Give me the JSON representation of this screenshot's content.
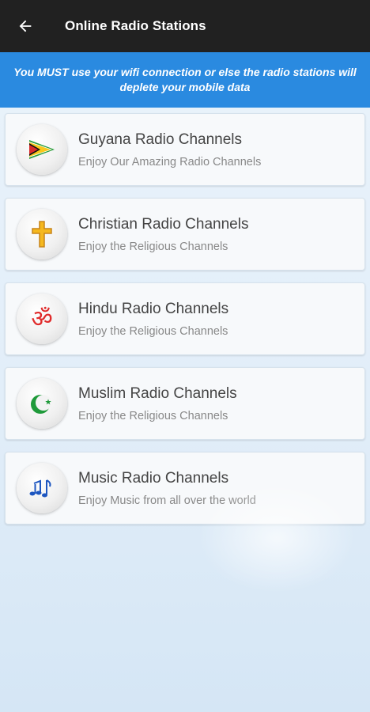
{
  "appbar": {
    "title": "Online Radio Stations",
    "back_icon": "arrow-left-icon"
  },
  "banner": {
    "text": "You MUST use your wifi connection or else the radio stations will deplete your mobile data"
  },
  "colors": {
    "appbar": "#212121",
    "banner": "#2a8ae0",
    "card_bg": "#f7f9fb"
  },
  "channels": [
    {
      "title": "Guyana Radio Channels",
      "subtitle": "Enjoy Our Amazing Radio Channels",
      "icon": "guyana-flag-icon"
    },
    {
      "title": "Christian Radio Channels",
      "subtitle": "Enjoy the Religious Channels",
      "icon": "cross-icon"
    },
    {
      "title": "Hindu Radio Channels",
      "subtitle": "Enjoy the Religious Channels",
      "icon": "om-icon"
    },
    {
      "title": "Muslim Radio Channels",
      "subtitle": "Enjoy the Religious Channels",
      "icon": "crescent-star-icon"
    },
    {
      "title": "Music Radio Channels",
      "subtitle": "Enjoy Music from all over the world",
      "icon": "music-notes-icon"
    }
  ]
}
